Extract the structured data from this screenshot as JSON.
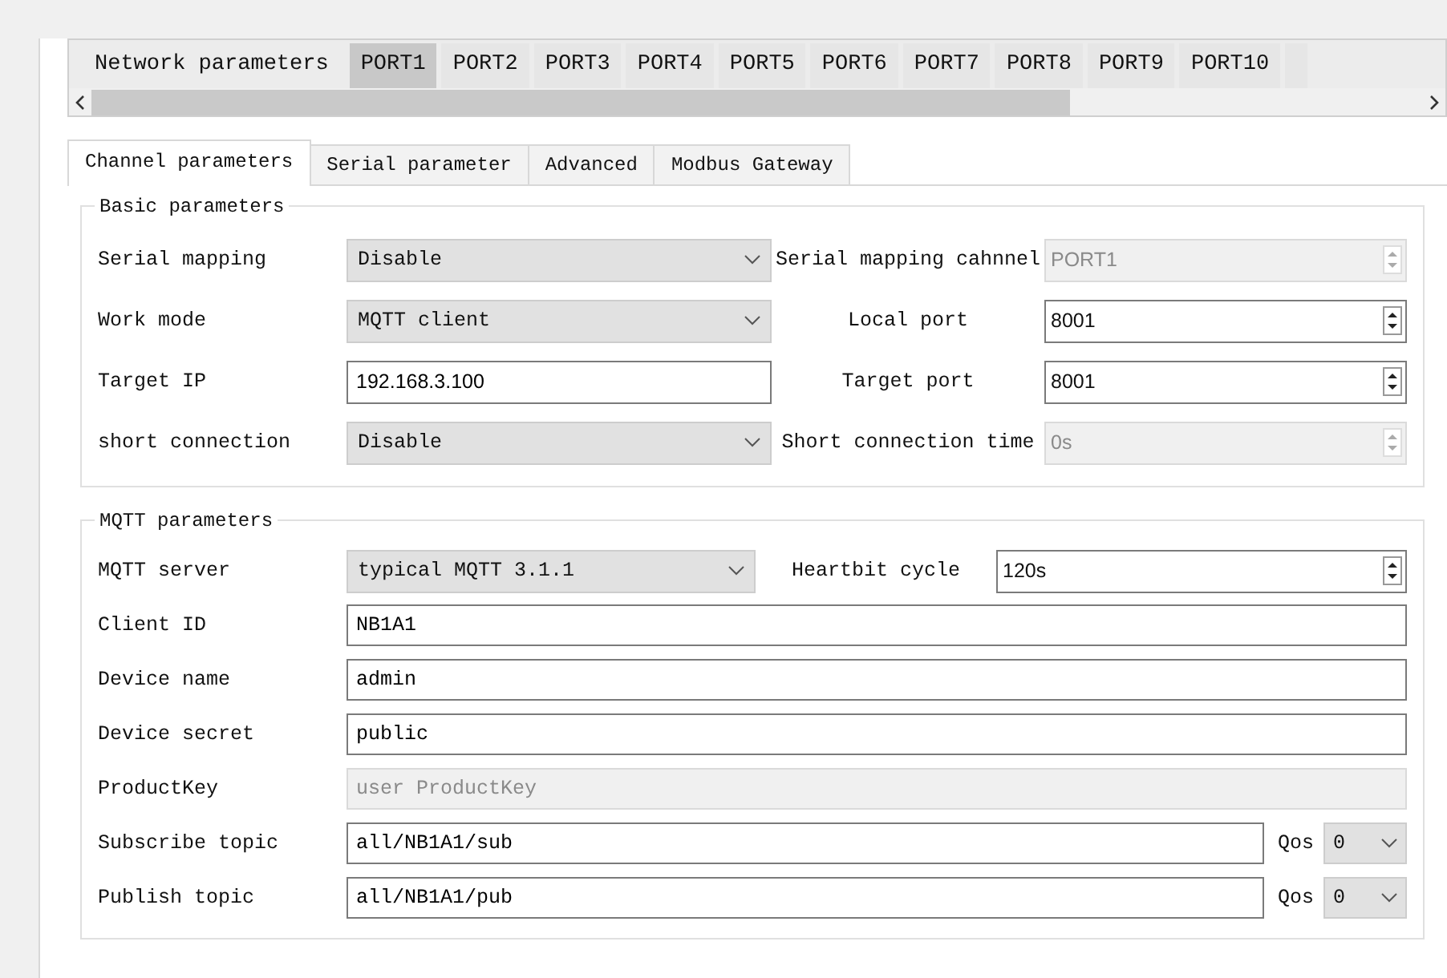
{
  "top_tabs": [
    {
      "label": "Network parameters",
      "selected": false
    },
    {
      "label": "PORT1",
      "selected": true
    },
    {
      "label": "PORT2",
      "selected": false
    },
    {
      "label": "PORT3",
      "selected": false
    },
    {
      "label": "PORT4",
      "selected": false
    },
    {
      "label": "PORT5",
      "selected": false
    },
    {
      "label": "PORT6",
      "selected": false
    },
    {
      "label": "PORT7",
      "selected": false
    },
    {
      "label": "PORT8",
      "selected": false
    },
    {
      "label": "PORT9",
      "selected": false
    },
    {
      "label": "PORT10",
      "selected": false
    }
  ],
  "sub_tabs": [
    {
      "label": "Channel parameters",
      "selected": true
    },
    {
      "label": "Serial parameter",
      "selected": false
    },
    {
      "label": "Advanced",
      "selected": false
    },
    {
      "label": "Modbus Gateway",
      "selected": false
    }
  ],
  "basic": {
    "title": "Basic parameters",
    "rows": [
      {
        "label": "Serial mapping",
        "kind": "select",
        "value": "Disable",
        "right_label": "Serial mapping cahnnel",
        "right_value": "PORT1",
        "right_disabled": true
      },
      {
        "label": "Work mode",
        "kind": "select",
        "value": "MQTT client",
        "right_label": "Local port",
        "right_value": "8001",
        "right_disabled": false
      },
      {
        "label": "Target IP",
        "kind": "text",
        "value": "192.168.3.100",
        "right_label": "Target port",
        "right_value": "8001",
        "right_disabled": false
      },
      {
        "label": "short connection",
        "kind": "select",
        "value": "Disable",
        "right_label": "Short connection time",
        "right_value": "0s",
        "right_disabled": true
      }
    ]
  },
  "mqtt": {
    "title": "MQTT parameters",
    "rows": [
      {
        "label": "MQTT server",
        "kind": "select-spin",
        "value": "typical MQTT 3.1.1",
        "right_label": "Heartbit cycle",
        "right_value": "120s"
      },
      {
        "label": "Client ID",
        "kind": "text",
        "value": "NB1A1"
      },
      {
        "label": "Device name",
        "kind": "text",
        "value": "admin"
      },
      {
        "label": "Device secret",
        "kind": "text",
        "value": "public"
      },
      {
        "label": "ProductKey",
        "kind": "disabled",
        "placeholder": "user ProductKey"
      },
      {
        "label": "Subscribe topic",
        "kind": "topic",
        "value": "all/NB1A1/sub",
        "qos_label": "Qos",
        "qos": "0"
      },
      {
        "label": "Publish topic",
        "kind": "topic",
        "value": "all/NB1A1/pub",
        "qos_label": "Qos",
        "qos": "0"
      }
    ]
  }
}
